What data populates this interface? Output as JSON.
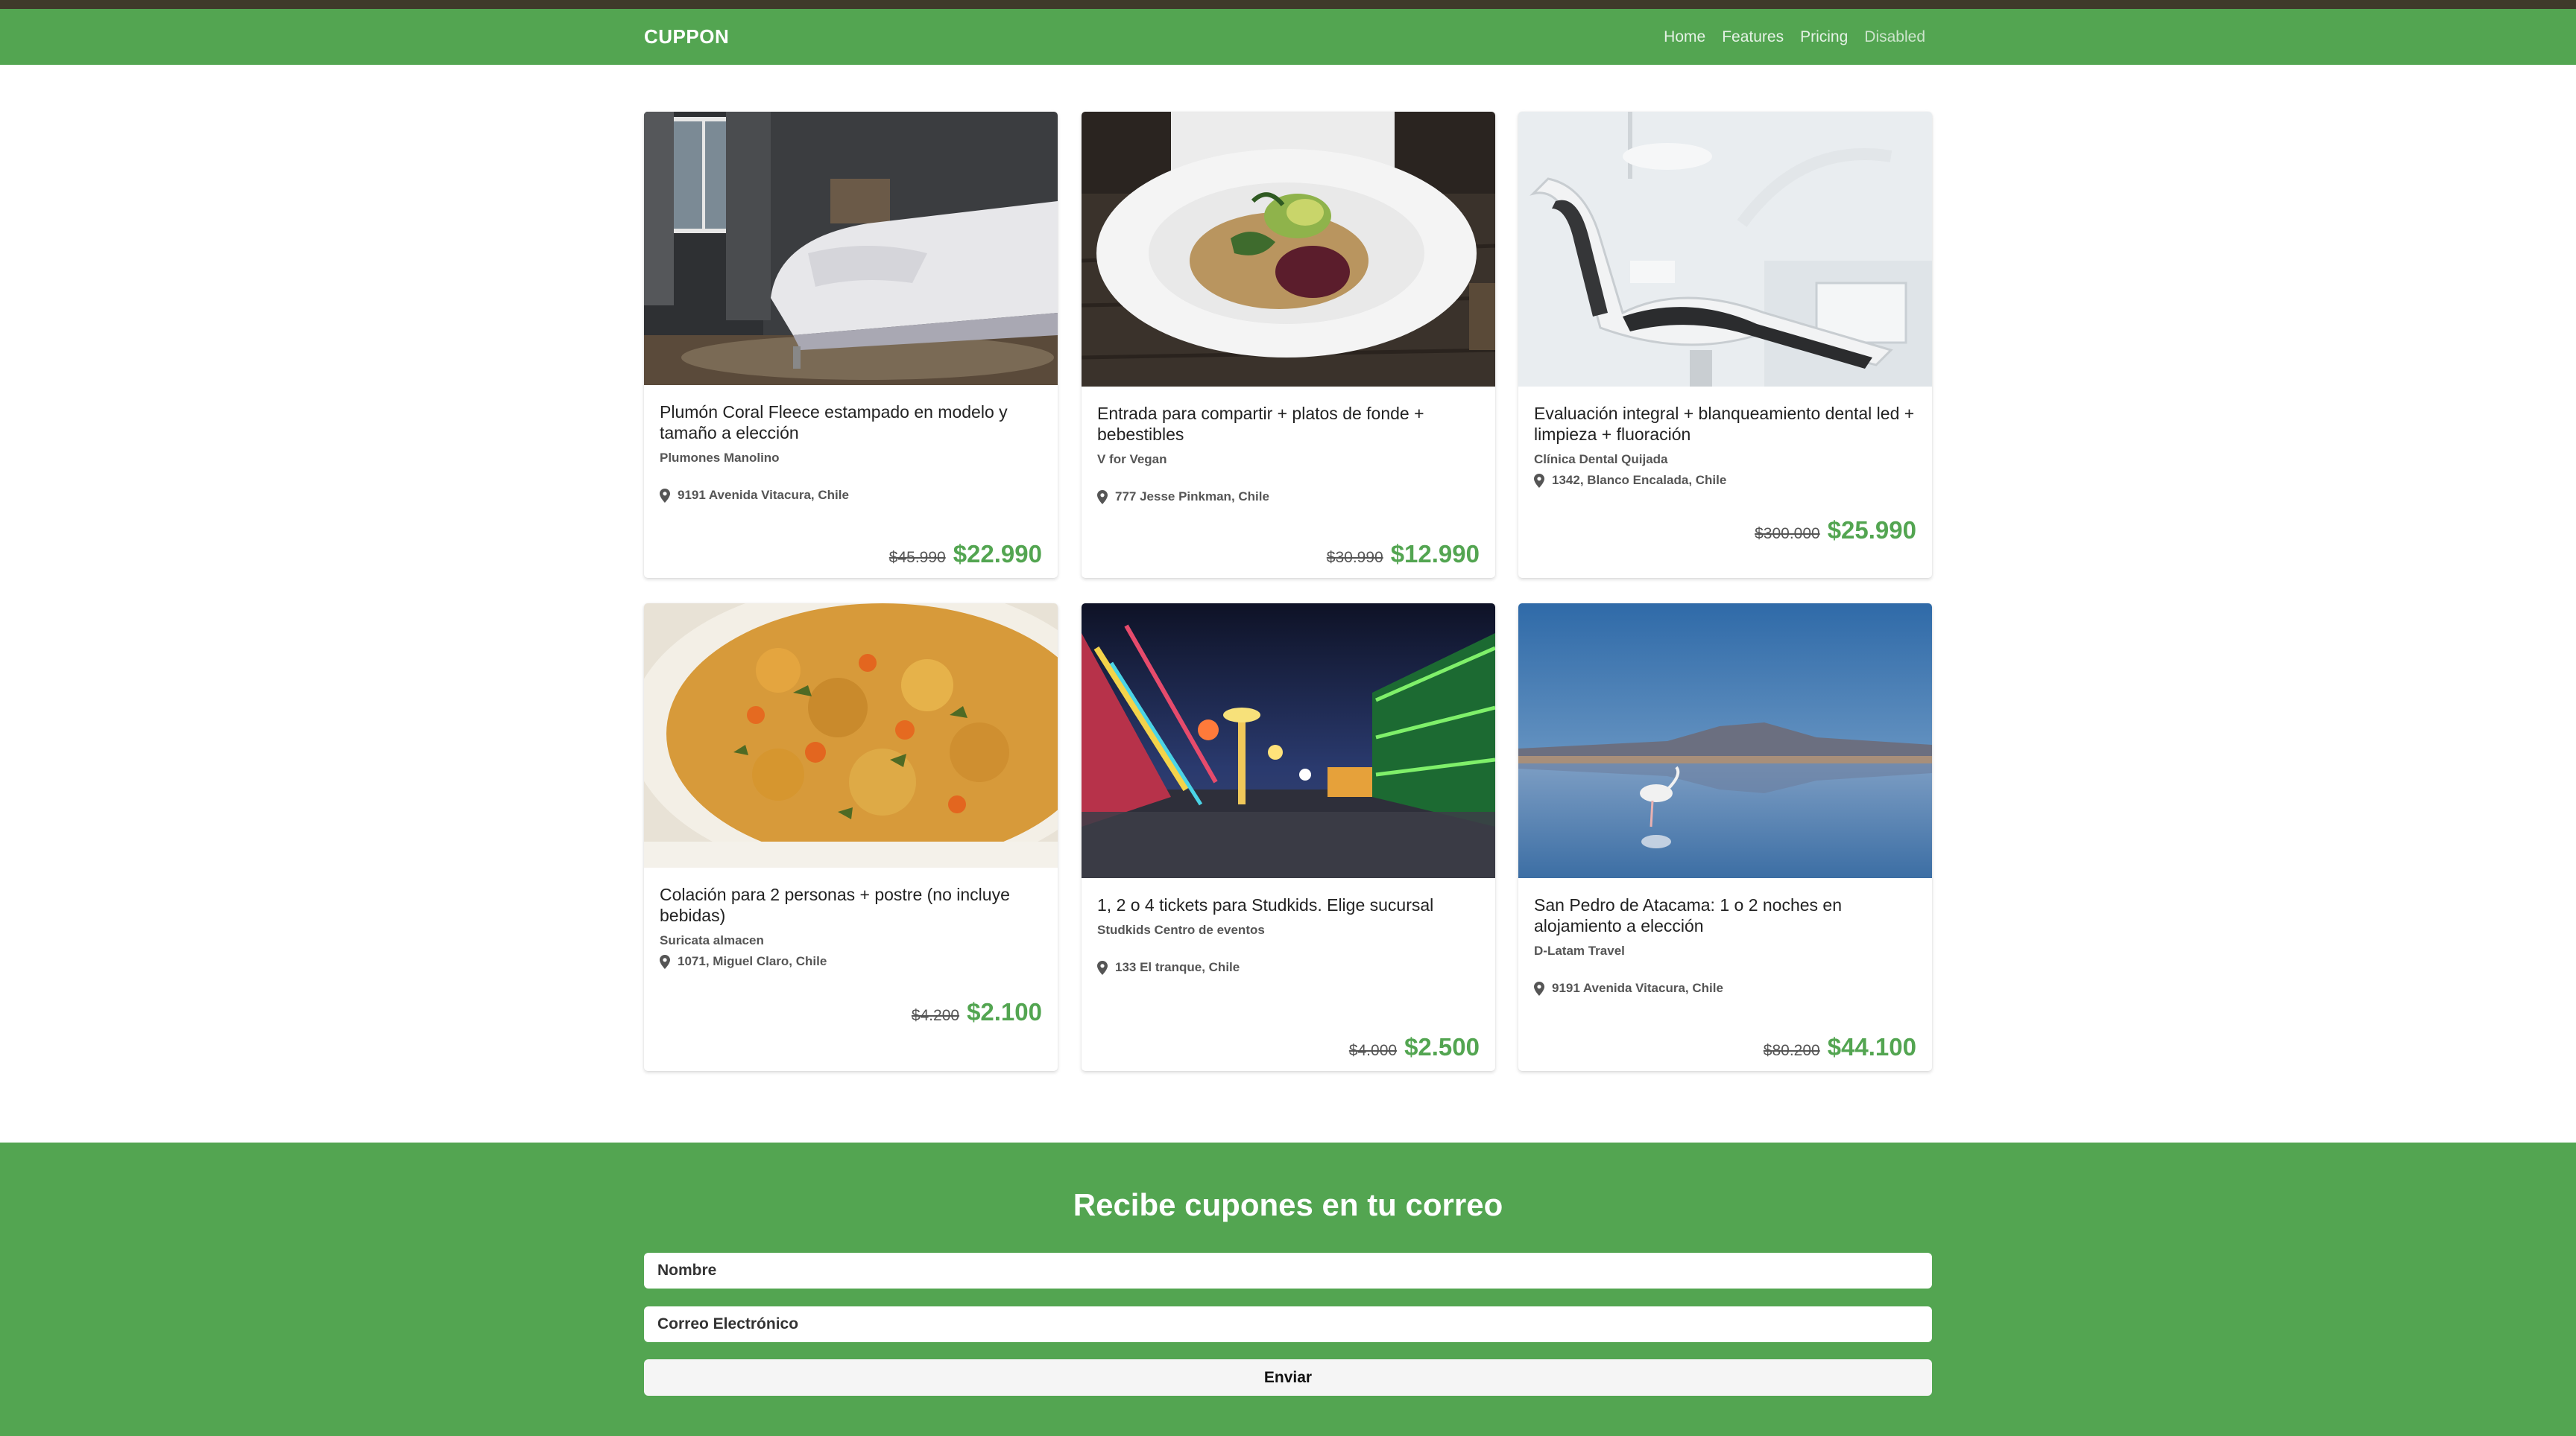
{
  "nav": {
    "brand": "CUPPON",
    "links": [
      "Home",
      "Features",
      "Pricing",
      "Disabled"
    ]
  },
  "colors": {
    "accent": "#53a551",
    "topstrip": "#3f3a2a"
  },
  "deals": [
    {
      "title": "Plumón Coral Fleece estampado en modelo y tamaño a elección",
      "merchant": "Plumones Manolino",
      "location": "9191 Avenida Vitacura, Chile",
      "old_price": "$45.990",
      "new_price": "$22.990",
      "image": "bedroom"
    },
    {
      "title": "Entrada para compartir + platos de fonde + bebestibles",
      "merchant": "V for Vegan",
      "location": "777 Jesse Pinkman, Chile",
      "old_price": "$30.990",
      "new_price": "$12.990",
      "image": "salad-plate"
    },
    {
      "title": "Evaluación integral + blanqueamiento dental led + limpieza + fluoración",
      "merchant": "Clínica Dental Quijada",
      "location": "1342, Blanco Encalada, Chile",
      "old_price": "$300.000",
      "new_price": "$25.990",
      "image": "dental-chair"
    },
    {
      "title": "Colación para 2 personas + postre (no incluye bebidas)",
      "merchant": "Suricata almacen",
      "location": "1071, Miguel Claro, Chile",
      "old_price": "$4.200",
      "new_price": "$2.100",
      "image": "stew-dish"
    },
    {
      "title": "1, 2 o 4 tickets para Studkids. Elige sucursal",
      "merchant": "Studkids Centro de eventos",
      "location": "133 El tranque, Chile",
      "old_price": "$4.000",
      "new_price": "$2.500",
      "image": "fairground-night"
    },
    {
      "title": "San Pedro de Atacama: 1 o 2 noches en alojamiento a elección",
      "merchant": "D-Latam Travel",
      "location": "9191 Avenida Vitacura, Chile",
      "old_price": "$80.200",
      "new_price": "$44.100",
      "image": "flamingo-lagoon"
    }
  ],
  "newsletter": {
    "title": "Recibe cupones en tu correo",
    "name_placeholder": "Nombre",
    "email_placeholder": "Correo Electrónico",
    "submit_label": "Enviar"
  }
}
